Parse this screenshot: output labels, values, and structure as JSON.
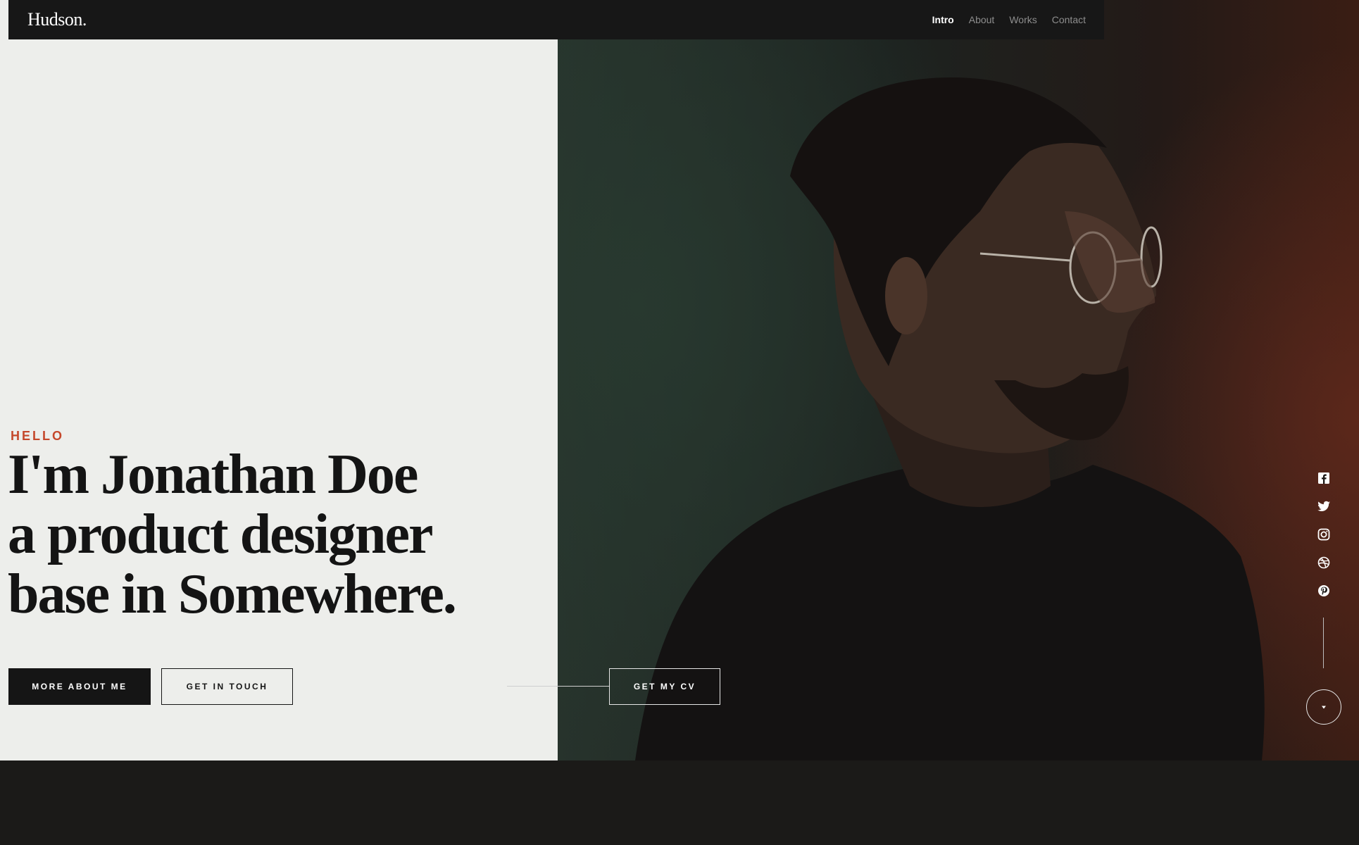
{
  "brand": {
    "logo": "Hudson."
  },
  "nav": {
    "items": [
      {
        "label": "Intro",
        "active": true
      },
      {
        "label": "About",
        "active": false
      },
      {
        "label": "Works",
        "active": false
      },
      {
        "label": "Contact",
        "active": false
      }
    ]
  },
  "hero": {
    "eyebrow": "HELLO",
    "headline": [
      "I'm Jonathan Doe",
      "a product designer",
      "base in Somewhere."
    ],
    "buttons": {
      "more_about": "MORE ABOUT ME",
      "get_in_touch": "GET IN TOUCH",
      "get_cv": "GET MY CV"
    }
  },
  "social": {
    "icons": [
      "facebook-icon",
      "twitter-icon",
      "instagram-icon",
      "dribbble-icon",
      "pinterest-icon"
    ]
  },
  "scroll": {
    "icon": "chevron-down-icon"
  },
  "colors": {
    "accent": "#c5482b",
    "dark": "#151515",
    "panel": "#edeeeb",
    "header": "#171717"
  }
}
